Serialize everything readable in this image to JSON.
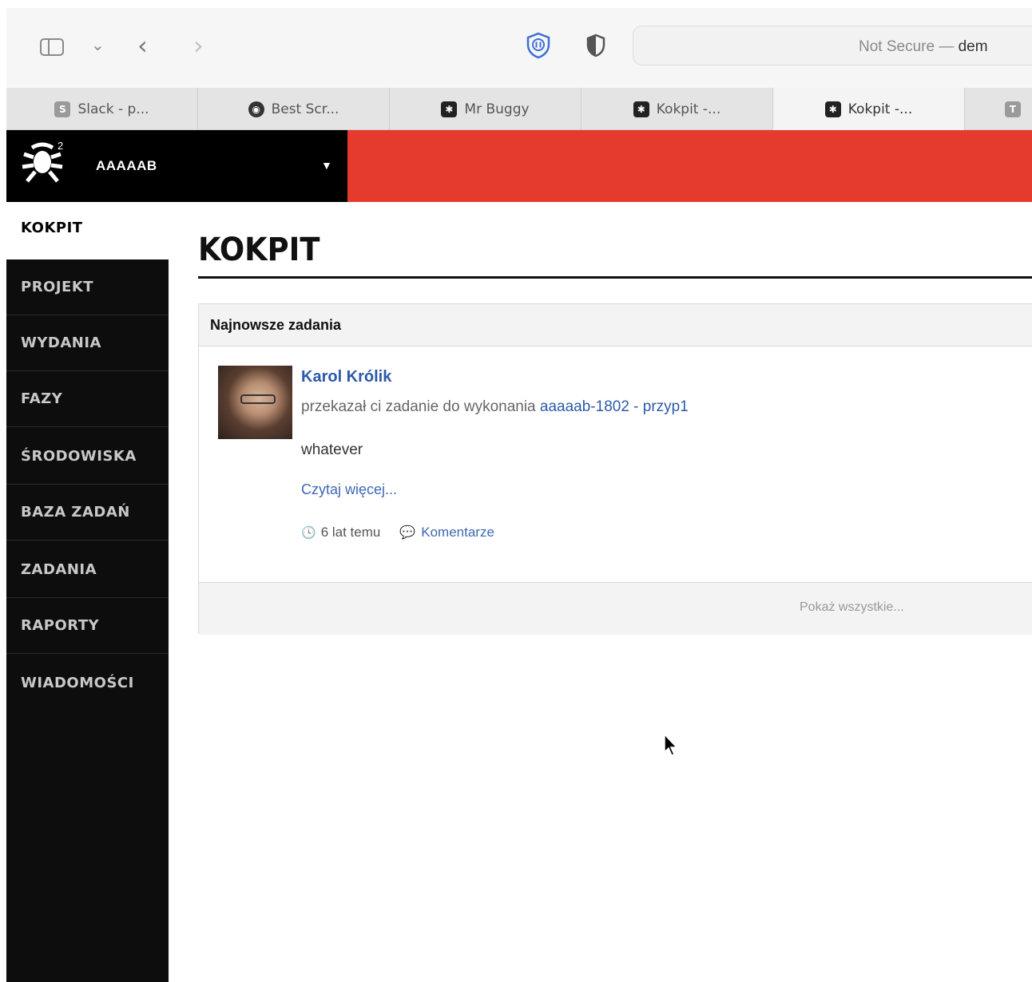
{
  "browser": {
    "address_prefix": "Not Secure — ",
    "address_host": "dem",
    "tabs": [
      {
        "label": "Slack - p...",
        "favicon": "S"
      },
      {
        "label": "Best Scr...",
        "favicon": "mask-icon"
      },
      {
        "label": "Mr Buggy",
        "favicon": "bug-icon"
      },
      {
        "label": "Kokpit -...",
        "favicon": "bug-icon"
      },
      {
        "label": "Kokpit -...",
        "favicon": "bug-icon",
        "active": true
      },
      {
        "label": "",
        "favicon": "T"
      }
    ]
  },
  "app": {
    "project_name": "AAAAAB",
    "dropdown_arrow": "▼",
    "accent_color": "#e53b2f",
    "nav": [
      {
        "label": "KOKPIT",
        "active": true
      },
      {
        "label": "PROJEKT"
      },
      {
        "label": "WYDANIA"
      },
      {
        "label": "FAZY"
      },
      {
        "label": "ŚRODOWISKA"
      },
      {
        "label": "BAZA ZADAŃ"
      },
      {
        "label": "ZADANIA"
      },
      {
        "label": "RAPORTY"
      },
      {
        "label": "WIADOMOŚCI"
      }
    ]
  },
  "main": {
    "title": "KOKPIT",
    "panel": {
      "heading": "Najnowsze zadania",
      "item": {
        "author": "Karol Królik",
        "action_text": "przekazał ci zadanie do wykonania ",
        "task_link": "aaaaab-1802 - przyp1",
        "body": "whatever",
        "read_more": "Czytaj więcej...",
        "time": "6 lat temu",
        "comments": "Komentarze"
      },
      "show_all": "Pokaż wszystkie..."
    }
  }
}
